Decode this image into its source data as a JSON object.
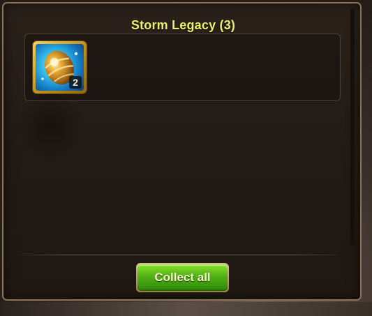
{
  "popup": {
    "title": "Storm Legacy (3)"
  },
  "rewards": [
    {
      "icon": "storm-egg-icon",
      "count": "2"
    }
  ],
  "actions": {
    "collect_all_label": "Collect all"
  },
  "colors": {
    "title": "#ecf06a",
    "panel_border": "#8b7458",
    "button_green": "#4fb114",
    "slot_gold": "#c89a20"
  }
}
